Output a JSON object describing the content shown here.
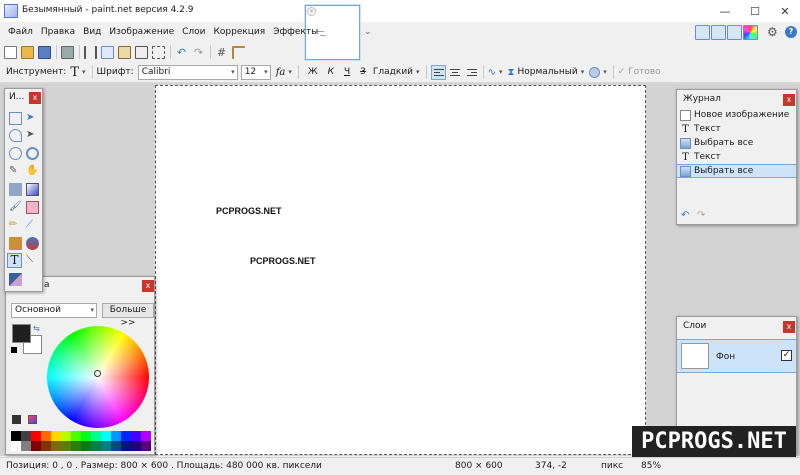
{
  "window": {
    "title": "Безымянный - paint.net версия 4.2.9",
    "minimize_glyph": "—",
    "maximize_glyph": "☐",
    "close_glyph": "✕"
  },
  "thumbnail": {
    "close_glyph": "×",
    "chevron": "⌄"
  },
  "menu": [
    "Файл",
    "Правка",
    "Вид",
    "Изображение",
    "Слои",
    "Коррекция",
    "Эффекты"
  ],
  "top_icons": [
    "tools-window-icon",
    "history-window-icon",
    "layers-window-icon",
    "colors-window-icon",
    "gear-icon",
    "help-icon"
  ],
  "toolbar": {
    "icons": [
      "new-icon",
      "open-icon",
      "save-icon",
      "print-icon",
      "cut-icon",
      "copy-icon",
      "paste-icon",
      "crop-icon",
      "deselect-icon",
      "undo-icon",
      "redo-icon",
      "grid-icon",
      "ruler-icon"
    ]
  },
  "tool_options": {
    "tool_label": "Инструмент:",
    "tool_glyph": "T",
    "font_label": "Шрифт:",
    "font_value": "Calibri",
    "size_value": "12",
    "bold": "Ж",
    "italic": "К",
    "underline": "Ч",
    "strike": "З",
    "antialias": "Гладкий",
    "blend_mode": "Нормальный",
    "done": "✓ Готово"
  },
  "canvas": {
    "texts": [
      "PCPROGS.NET",
      "PCPROGS.NET"
    ]
  },
  "tools_window": {
    "title": "И...",
    "close_glyph": "x",
    "items": [
      "rectangle-select-icon",
      "move-selection-icon",
      "lasso-icon",
      "move-icon",
      "ellipse-select-icon",
      "zoom-icon",
      "magic-wand-icon",
      "pan-icon",
      "paint-bucket-icon",
      "gradient-icon",
      "paintbrush-icon",
      "eraser-icon",
      "pencil-icon",
      "color-picker-icon",
      "clone-stamp-icon",
      "recolor-icon",
      "text-icon",
      "line-icon",
      "shapes-icon"
    ]
  },
  "colors_window": {
    "title": "а",
    "close_glyph": "x",
    "primary_option": "Основной",
    "more_label": "Больше >>",
    "swap_glyph": "⇆",
    "primary_color": "#1f1f1f",
    "secondary_color": "#ffffff",
    "palette": [
      "#000000",
      "#404040",
      "#ff0000",
      "#ff6a00",
      "#ffd800",
      "#b6ff00",
      "#4cff00",
      "#00ff21",
      "#00ff90",
      "#00ffff",
      "#0094ff",
      "#0026ff",
      "#4800ff",
      "#b200ff",
      "#ffffff",
      "#808080",
      "#7f0000",
      "#7f3300",
      "#7f6a00",
      "#5b7f00",
      "#267f00",
      "#007f0e",
      "#007f46",
      "#007f7f",
      "#004a7f",
      "#00137f",
      "#21007f",
      "#57007f"
    ]
  },
  "history_window": {
    "title": "Журнал",
    "close_glyph": "x",
    "items": [
      {
        "label": "Новое изображение",
        "icon": "doc"
      },
      {
        "label": "Текст",
        "icon": "text"
      },
      {
        "label": "Выбрать все",
        "icon": "img"
      },
      {
        "label": "Текст",
        "icon": "text"
      },
      {
        "label": "Выбрать все",
        "icon": "img",
        "selected": true
      }
    ],
    "undo_glyph": "↶",
    "redo_glyph": "↷"
  },
  "layers_window": {
    "title": "Слои",
    "close_glyph": "x",
    "layer_name": "Фон",
    "visible_glyph": "✓"
  },
  "watermark": "PCPROGS.NET",
  "status": {
    "text": "Позиция: 0 , 0 . Размер: 800 × 600 . Площадь: 480 000 кв. пиксели",
    "image_size": "800 × 600",
    "cursor": "374, -2",
    "units": "пикс",
    "zoom": "85%"
  }
}
